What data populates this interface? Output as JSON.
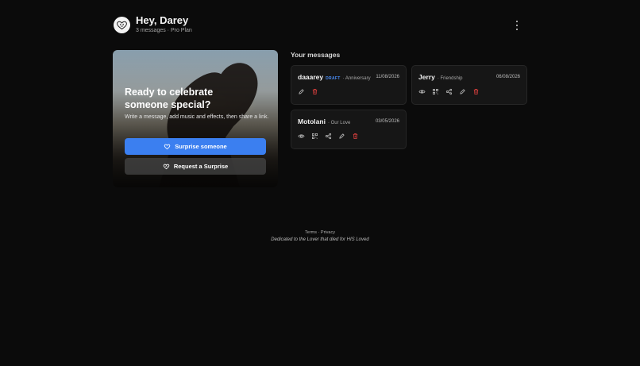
{
  "header": {
    "greeting": "Hey, Darey",
    "subline": "3 messages · Pro Plan",
    "avatar_icon": "heart-face-icon",
    "menu_icon": "kebab-menu-icon"
  },
  "hero": {
    "title": "Ready to celebrate someone special?",
    "description": "Write a message, add music and effects, then share a link.",
    "primary_button": "Surprise someone",
    "secondary_button": "Request a Surprise",
    "primary_icon": "heart-icon",
    "secondary_icon": "heart-outline-icon"
  },
  "messages": {
    "title": "Your messages",
    "items": [
      {
        "name": "daaarey",
        "badge": "DRAFT",
        "occasion": "· Anniversary",
        "date": "11/08/2026",
        "actions": [
          "edit-icon",
          "delete-icon"
        ]
      },
      {
        "name": "Jerry",
        "badge": "",
        "occasion": "· Friendship",
        "date": "06/08/2026",
        "actions": [
          "view-icon",
          "qr-icon",
          "share-icon",
          "edit-icon",
          "delete-icon"
        ]
      },
      {
        "name": "Motolani",
        "badge": "",
        "occasion": "· Our Love",
        "date": "03/05/2026",
        "actions": [
          "view-icon",
          "qr-icon",
          "share-icon",
          "edit-icon",
          "delete-icon"
        ]
      }
    ]
  },
  "footer": {
    "terms": "Terms",
    "separator": "·",
    "privacy": "Privacy",
    "dedication": "Dedicated to the Lover that died for HIS Loved"
  },
  "colors": {
    "background": "#0b0b0b",
    "accent": "#3b7ff0",
    "danger": "#e0413f",
    "draft": "#4a8cf5"
  }
}
